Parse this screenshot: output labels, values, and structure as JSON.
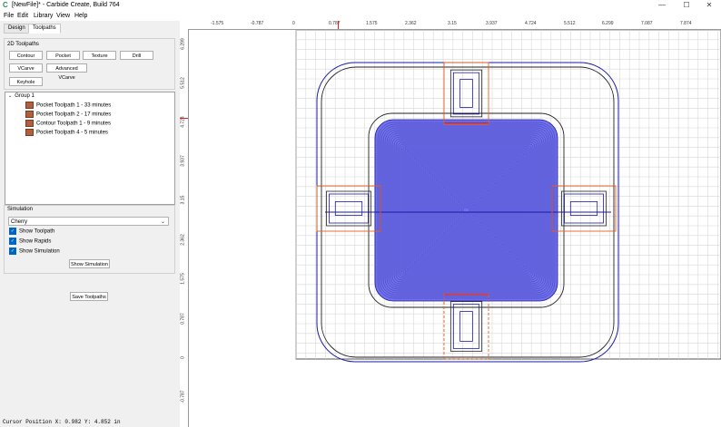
{
  "window": {
    "title": "[NewFile]* - Carbide Create, Build 764",
    "app_icon": "C",
    "minimize": "—",
    "maximize": "☐",
    "close": "✕"
  },
  "menu": [
    "File",
    "Edit",
    "Library",
    "View",
    "Help"
  ],
  "tabs": [
    "Design",
    "Toolpaths"
  ],
  "toolpaths_header": "2D Toolpaths",
  "toolpath_buttons": {
    "contour": "Contour",
    "pocket": "Pocket",
    "texture": "Texture",
    "drill": "Drill",
    "vcarve": "VCarve",
    "advanced_vcarve": "Advanced VCarve",
    "keyhole": "Keyhole"
  },
  "tree": {
    "group": "Group 1",
    "items": [
      "Pocket Toolpath 1 - 33 minutes",
      "Pocket Toolpath 2 - 17 minutes",
      "Contour Toolpath 1 - 9 minutes",
      "Pocket Toolpath 4 - 5 minutes"
    ]
  },
  "simulation": {
    "label": "Simulation",
    "material": "Cherry",
    "show_toolpath": "Show Toolpath",
    "show_rapids": "Show Rapids",
    "show_simulation": "Show Simulation",
    "show_simulation_button": "Show Simulation"
  },
  "save_button": "Save Toolpaths",
  "status": "Cursor Position X: 0.982 Y: 4.852 in",
  "ruler": {
    "top": [
      "-1.575",
      "-0.787",
      "0",
      "0.787",
      "1.575",
      "2.362",
      "3.15",
      "3.937",
      "4.724",
      "5.512",
      "6.299",
      "7.087",
      "7.874"
    ],
    "left": [
      "6.299",
      "5.512",
      "4.724",
      "3.937",
      "3.15",
      "2.362",
      "1.575",
      "0.787",
      "0",
      "-0.787"
    ]
  },
  "colors": {
    "pocket_fill": "#7070e8",
    "toolpath_line": "#1a1aa8",
    "outline": "#222222",
    "rapid": "#e86020",
    "grid": "#d8d8d8",
    "ruler_marker": "#e02020"
  }
}
